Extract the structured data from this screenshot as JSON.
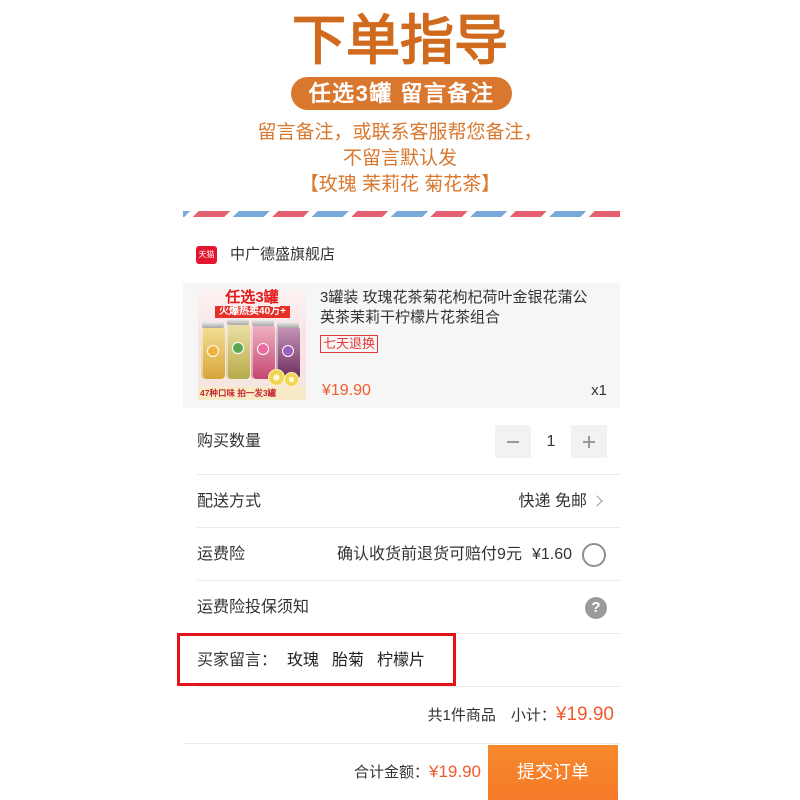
{
  "header": {
    "title": "下单指导",
    "pill": "任选3罐 留言备注",
    "notes": [
      "留言备注，或联系客服帮您备注，",
      "不留言默认发",
      "【玫瑰 茉莉花 菊花茶】"
    ]
  },
  "store": {
    "icon": "tmall-icon",
    "icon_label": "天猫",
    "name": "中广德盛旗舰店"
  },
  "product": {
    "image": {
      "headline": "任选3罐",
      "banner": "火爆热卖40万+",
      "footer": "47种口味 拍一发3罐"
    },
    "title_lines": [
      "3罐装 玫瑰花茶菊花枸杞荷叶金银花蒲公",
      "英茶茉莉干柠檬片花茶组合"
    ],
    "badge": "七天退换",
    "price": "¥19.90",
    "quantity": "x1"
  },
  "order": {
    "quantity": {
      "label": "购买数量",
      "value": "1",
      "decrease_icon": "minus-icon",
      "increase_icon": "plus-icon"
    },
    "delivery": {
      "label": "配送方式",
      "value": "快递 免邮",
      "icon": "chevron-right-icon"
    },
    "insurance": {
      "label": "运费险",
      "description": "确认收货前退货可赔付9元",
      "price": "¥1.60",
      "checked": false,
      "icon": "radio-icon"
    },
    "insurance_notice": {
      "label": "运费险投保须知",
      "icon": "question-icon"
    },
    "buyer_message": {
      "label": "买家留言：",
      "items": [
        "玫瑰",
        "胎菊",
        "柠檬片"
      ]
    },
    "subtotal": {
      "count_text": "共1件商品",
      "label": "小计：",
      "amount": "¥19.90"
    }
  },
  "footer": {
    "total_label": "合计金额：",
    "total_amount": "¥19.90",
    "submit_label": "提交订单"
  },
  "colors": {
    "title": "#d06a1e",
    "accent": "#d8772d",
    "price": "#f25a2c",
    "button": "#f57a2a",
    "badge": "#e5383a",
    "highlight": "#e3121b",
    "stripe_red": "#e46070",
    "stripe_blue": "#79a9d9",
    "tmall": "#e3152f"
  }
}
